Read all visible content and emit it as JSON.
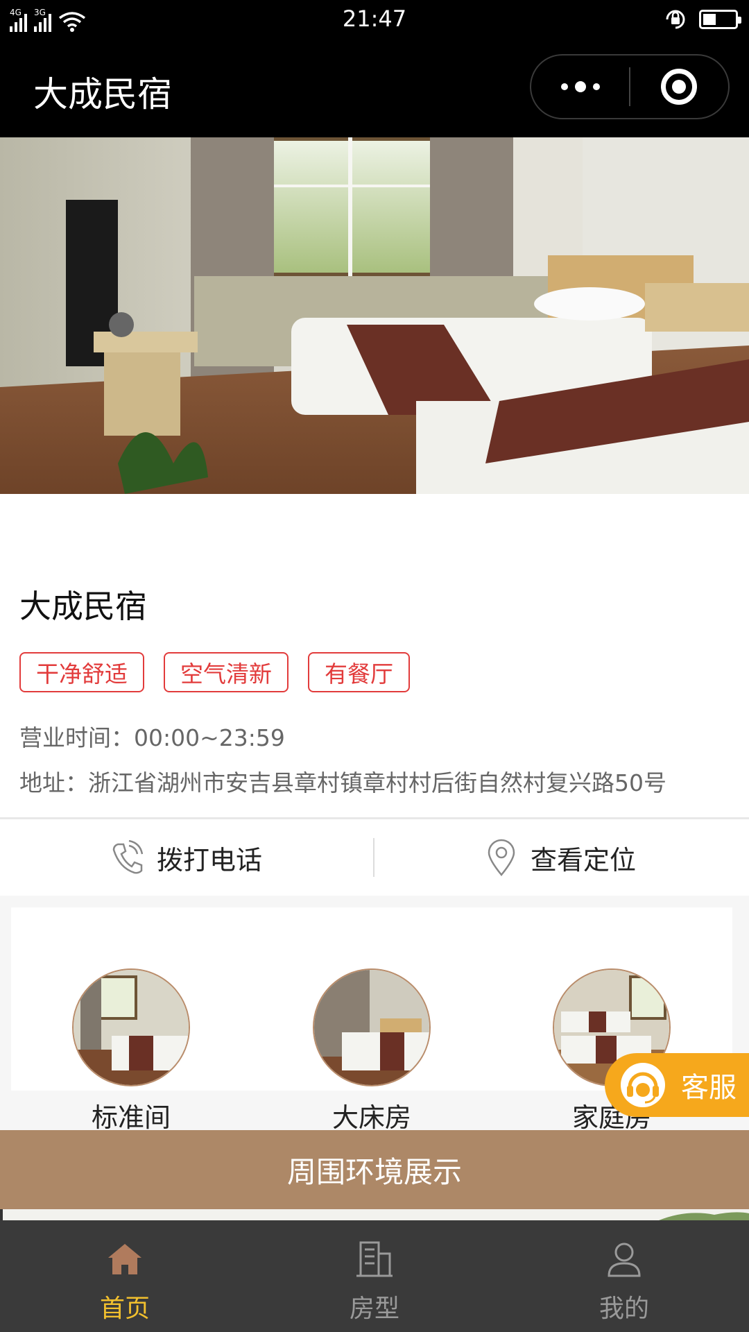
{
  "status_bar": {
    "signal_1_label": "4G",
    "signal_2_label": "3G",
    "time": "21:47",
    "battery_level": 0.4
  },
  "nav": {
    "title": "大成民宿"
  },
  "shop": {
    "name": "大成民宿",
    "tags": [
      "干净舒适",
      "空气清新",
      "有餐厅"
    ],
    "hours": "营业时间：00:00~23:59",
    "address": "地址：浙江省湖州市安吉县章村镇章村村后街自然村复兴路50号"
  },
  "actions": {
    "call_label": "拨打电话",
    "location_label": "查看定位"
  },
  "rooms": [
    {
      "name": "标准间"
    },
    {
      "name": "大床房"
    },
    {
      "name": "家庭房"
    }
  ],
  "customer_service": {
    "label": "客服"
  },
  "environment": {
    "banner": "周围环境展示"
  },
  "tabbar": {
    "items": [
      {
        "label": "首页",
        "icon": "home-icon",
        "active": true
      },
      {
        "label": "房型",
        "icon": "building-icon",
        "active": false
      },
      {
        "label": "我的",
        "icon": "user-icon",
        "active": false
      }
    ]
  },
  "colors": {
    "tag_red": "#e23b3b",
    "banner_brown": "#ad8867",
    "kefu_orange": "#f6a81c",
    "tab_active": "#f2c02e",
    "tab_bg": "#3a3a3a"
  }
}
